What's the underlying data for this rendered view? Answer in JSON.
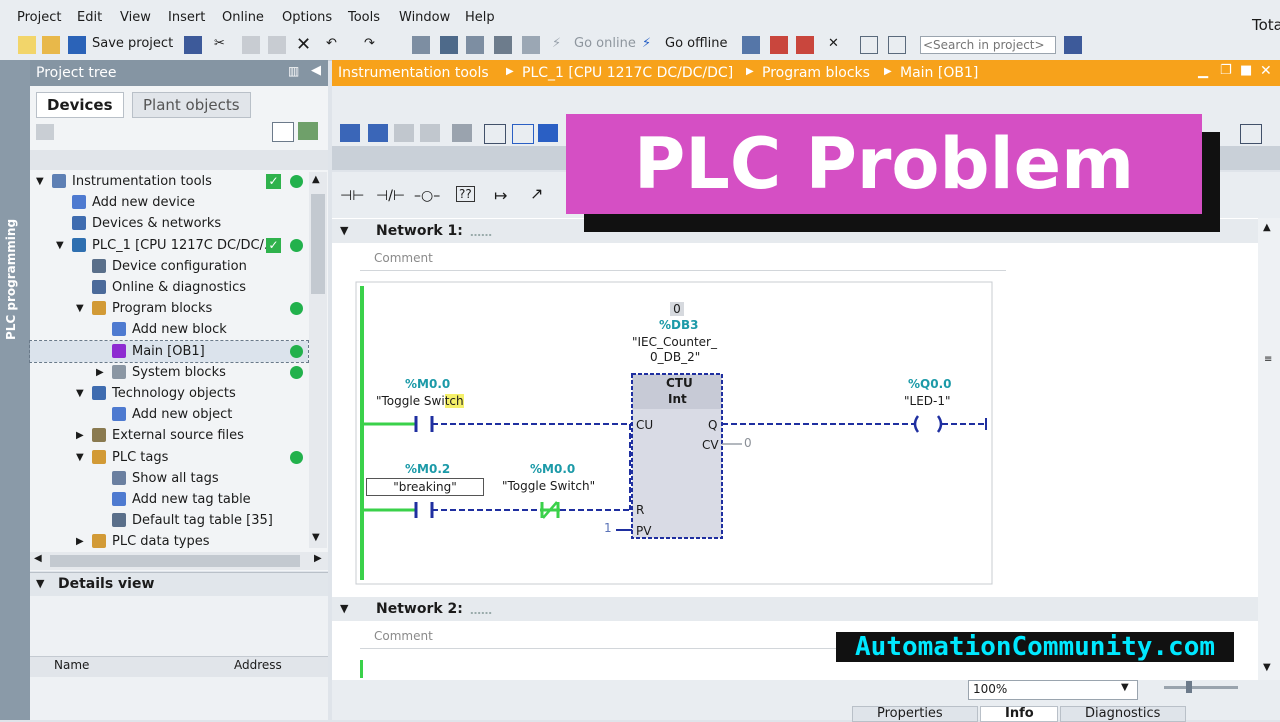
{
  "menu": [
    "Project",
    "Edit",
    "View",
    "Insert",
    "Online",
    "Options",
    "Tools",
    "Window",
    "Help"
  ],
  "app_title_partial": "Tota",
  "toolbar": {
    "save_project": "Save project",
    "go_online": "Go online",
    "go_offline": "Go offline",
    "search_placeholder": "<Search in project>"
  },
  "side_strip": "PLC programming",
  "project_tree": {
    "title": "Project tree",
    "tabs": [
      "Devices",
      "Plant objects"
    ],
    "items": [
      {
        "label": "Instrumentation tools",
        "indent": 0,
        "arrow": "▼",
        "check": true,
        "dot": true
      },
      {
        "label": "Add new device",
        "indent": 1,
        "arrow": "",
        "check": false,
        "dot": false
      },
      {
        "label": "Devices & networks",
        "indent": 1,
        "arrow": "",
        "check": false,
        "dot": false
      },
      {
        "label": "PLC_1 [CPU 1217C DC/DC/...",
        "indent": 1,
        "arrow": "▼",
        "check": true,
        "dot": true
      },
      {
        "label": "Device configuration",
        "indent": 2,
        "arrow": "",
        "check": false,
        "dot": false
      },
      {
        "label": "Online & diagnostics",
        "indent": 2,
        "arrow": "",
        "check": false,
        "dot": false
      },
      {
        "label": "Program blocks",
        "indent": 2,
        "arrow": "▼",
        "check": false,
        "dot": true
      },
      {
        "label": "Add new block",
        "indent": 3,
        "arrow": "",
        "check": false,
        "dot": false
      },
      {
        "label": "Main [OB1]",
        "indent": 3,
        "arrow": "",
        "check": false,
        "dot": true,
        "selected": true
      },
      {
        "label": "System blocks",
        "indent": 3,
        "arrow": "▶",
        "check": false,
        "dot": true
      },
      {
        "label": "Technology objects",
        "indent": 2,
        "arrow": "▼",
        "check": false,
        "dot": false
      },
      {
        "label": "Add new object",
        "indent": 3,
        "arrow": "",
        "check": false,
        "dot": false
      },
      {
        "label": "External source files",
        "indent": 2,
        "arrow": "▶",
        "check": false,
        "dot": false
      },
      {
        "label": "PLC tags",
        "indent": 2,
        "arrow": "▼",
        "check": false,
        "dot": true
      },
      {
        "label": "Show all tags",
        "indent": 3,
        "arrow": "",
        "check": false,
        "dot": false
      },
      {
        "label": "Add new tag table",
        "indent": 3,
        "arrow": "",
        "check": false,
        "dot": false
      },
      {
        "label": "Default tag table [35]",
        "indent": 3,
        "arrow": "",
        "check": false,
        "dot": false
      },
      {
        "label": "PLC data types",
        "indent": 2,
        "arrow": "▶",
        "check": false,
        "dot": false
      }
    ]
  },
  "details_view": {
    "title": "Details view",
    "col_name": "Name",
    "col_address": "Address"
  },
  "editor": {
    "breadcrumb": [
      "Instrumentation tools",
      "PLC_1 [CPU 1217C DC/DC/DC]",
      "Program blocks",
      "Main [OB1]"
    ],
    "networks": [
      {
        "title": "Network 1:",
        "comment": "Comment"
      },
      {
        "title": "Network 2:",
        "comment": "Comment"
      }
    ],
    "ladder": {
      "db_value": "0",
      "db_addr": "%DB3",
      "db_name_1": "\"IEC_Counter_",
      "db_name_2": "0_DB_2\"",
      "ctu_label": "CTU",
      "ctu_type": "Int",
      "pin_cu": "CU",
      "pin_q": "Q",
      "pin_cv": "CV",
      "cv_value": "0",
      "pin_r": "R",
      "pin_pv": "PV",
      "pv_value": "1",
      "c1_addr": "%M0.0",
      "c1_name_a": "\"Toggle Swi",
      "c1_name_b": "tch",
      "c2_addr": "%M0.2",
      "c2_name": "\"breaking\"",
      "c3_addr": "%M0.0",
      "c3_name": "\"Toggle Switch\"",
      "coil_addr": "%Q0.0",
      "coil_name": "\"LED-1\""
    },
    "zoom": "100%"
  },
  "bottom_tabs": [
    "Properties",
    "Info",
    "Diagnostics"
  ],
  "overlay": {
    "banner": "PLC Problem",
    "watermark": "AutomationCommunity.com"
  },
  "colors": {
    "orange": "#f7a21b",
    "green": "#22b14c",
    "banner": "#d54fc4",
    "ladder_blue": "#1f2fa0",
    "rail_green": "#3ad14a"
  }
}
